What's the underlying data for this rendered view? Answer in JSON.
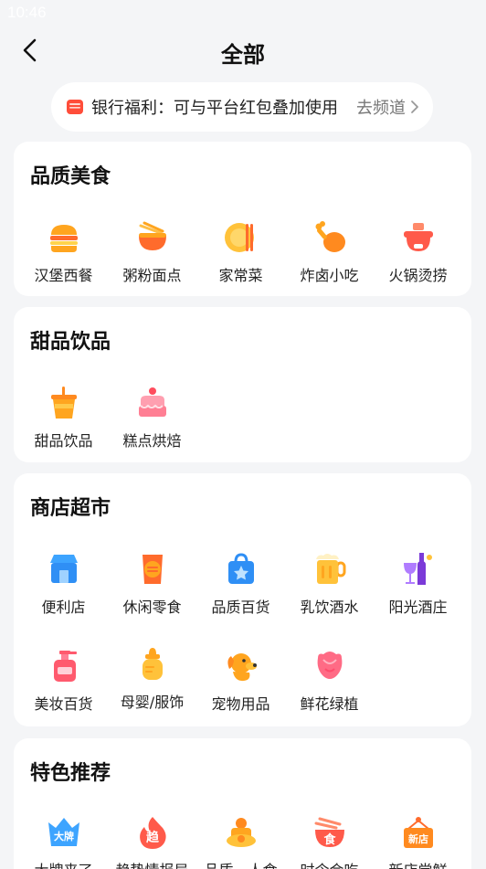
{
  "status_bar": {
    "time": "10:46"
  },
  "header": {
    "title": "全部",
    "back_icon": "chevron-left-icon"
  },
  "banner": {
    "icon": "bank-card-icon",
    "text": "银行福利：可与平台红包叠加使用",
    "link_label": "去频道",
    "chevron_icon": "chevron-right-icon"
  },
  "colors": {
    "background": "#f4f5f7",
    "card": "#ffffff",
    "accent_orange": "#ff9a1f",
    "accent_red": "#ff5a4a",
    "accent_blue": "#2f8ff5"
  },
  "sections": [
    {
      "title": "品质美食",
      "items": [
        {
          "label": "汉堡西餐",
          "icon": "burger-icon"
        },
        {
          "label": "粥粉面点",
          "icon": "noodle-bowl-icon"
        },
        {
          "label": "家常菜",
          "icon": "dish-plate-icon"
        },
        {
          "label": "炸卤小吃",
          "icon": "fried-chicken-leg-icon"
        },
        {
          "label": "火锅烫捞",
          "icon": "hotpot-icon"
        }
      ]
    },
    {
      "title": "甜品饮品",
      "items": [
        {
          "label": "甜品饮品",
          "icon": "bubble-tea-icon"
        },
        {
          "label": "糕点烘焙",
          "icon": "cake-icon"
        }
      ]
    },
    {
      "title": "商店超市",
      "items": [
        {
          "label": "便利店",
          "icon": "store-icon"
        },
        {
          "label": "休闲零食",
          "icon": "snack-bag-icon"
        },
        {
          "label": "品质百货",
          "icon": "shopping-bag-icon"
        },
        {
          "label": "乳饮酒水",
          "icon": "beer-mug-icon"
        },
        {
          "label": "阳光酒庄",
          "icon": "wine-icon"
        },
        {
          "label": "美妆百货",
          "icon": "cosmetic-bottle-icon"
        },
        {
          "label": "母婴/服饰",
          "icon": "baby-bottle-icon"
        },
        {
          "label": "宠物用品",
          "icon": "dog-icon"
        },
        {
          "label": "鲜花绿植",
          "icon": "flower-icon"
        }
      ]
    },
    {
      "title": "特色推荐",
      "items": [
        {
          "label": "大牌来了",
          "icon": "brand-crown-icon",
          "badge": "大牌"
        },
        {
          "label": "趋势情报局",
          "icon": "trend-fire-icon",
          "badge": "趋"
        },
        {
          "label": "品质一人食",
          "icon": "single-meal-icon"
        },
        {
          "label": "时令会吃",
          "icon": "seasonal-food-icon",
          "badge": "食"
        },
        {
          "label": "新店尝鲜",
          "icon": "new-store-icon",
          "badge": "新店"
        }
      ]
    }
  ]
}
